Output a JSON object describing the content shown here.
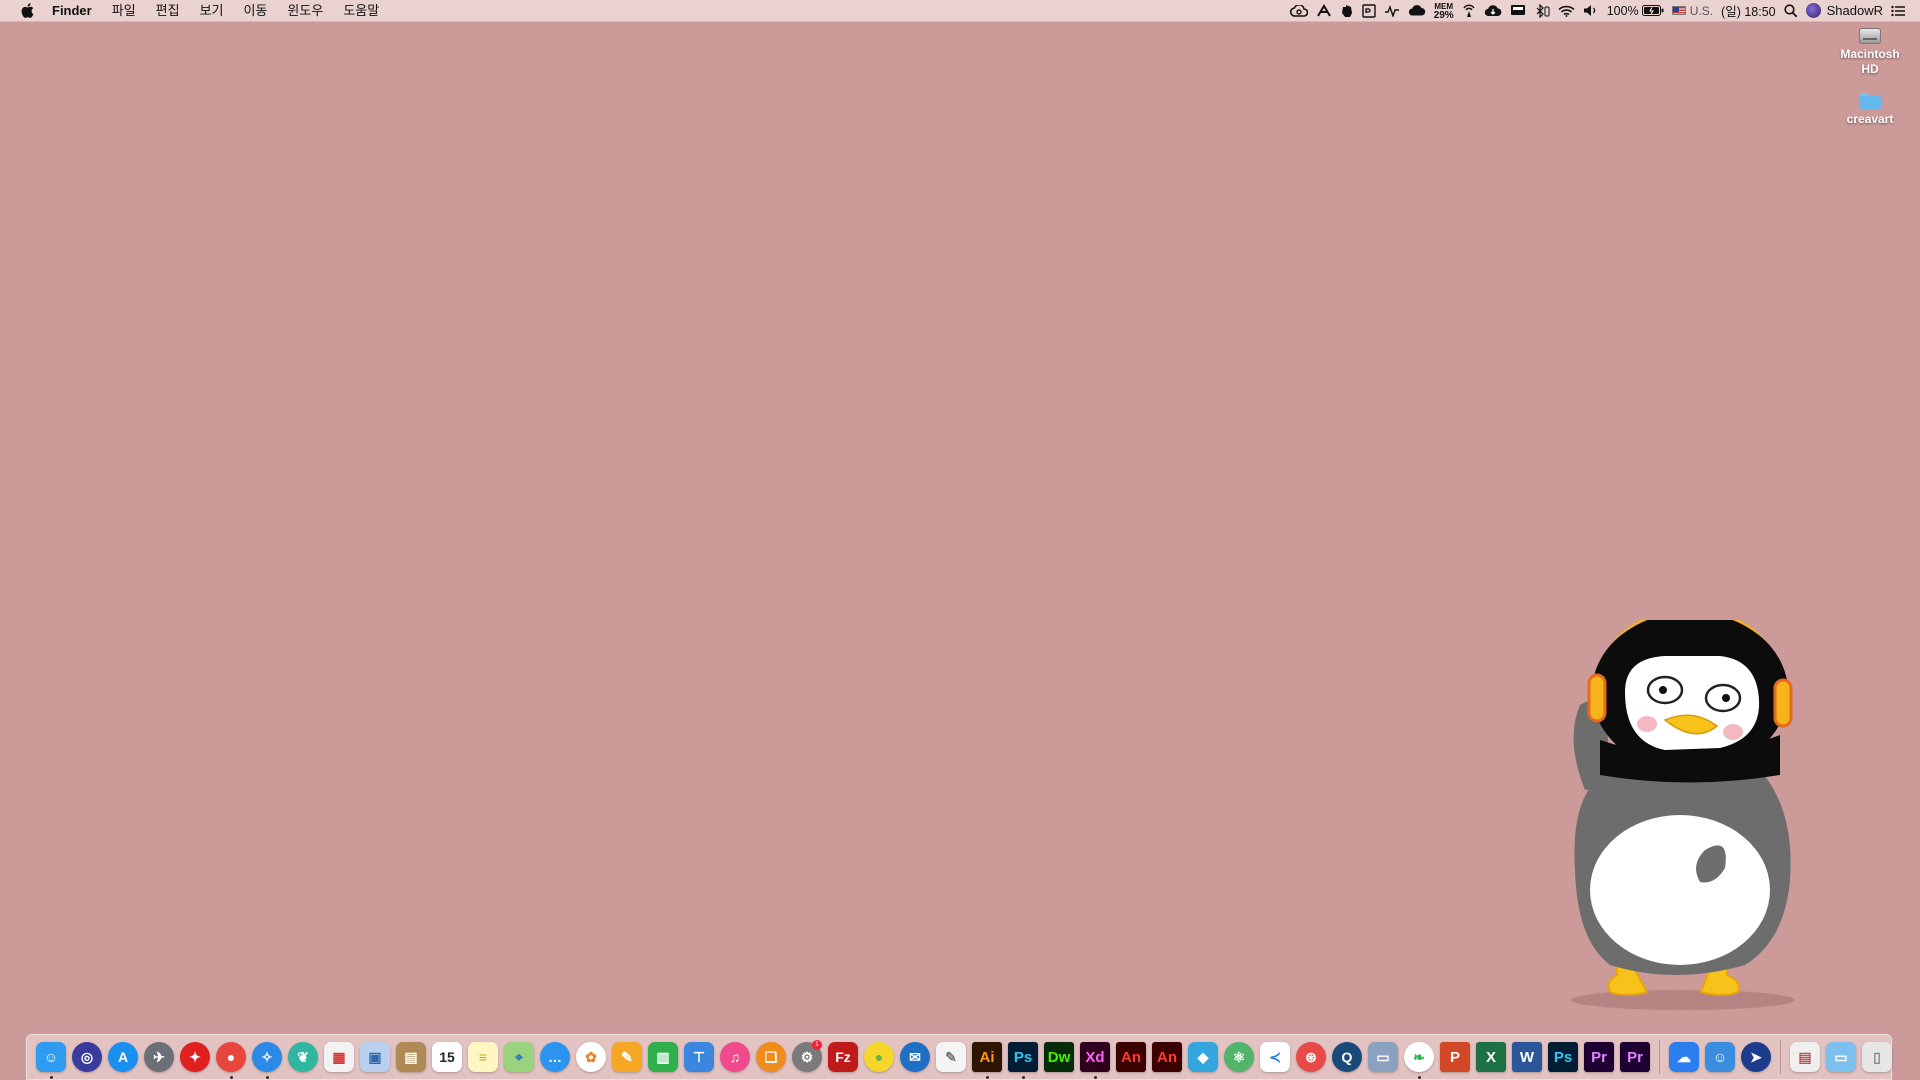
{
  "menubar": {
    "app_name": "Finder",
    "menus": [
      "파일",
      "편집",
      "보기",
      "이동",
      "윈도우",
      "도움말"
    ],
    "status": {
      "mem_label": "MEM",
      "mem_value": "29%",
      "battery": "100%",
      "input_source": "U.S.",
      "clock": "(일) 18:50",
      "user": "ShadowR"
    }
  },
  "desktop": {
    "icons": [
      {
        "label": "Macintosh HD"
      },
      {
        "label": "creavart"
      }
    ]
  },
  "dock": {
    "apps": [
      {
        "name": "Finder",
        "icon": "finder-icon",
        "bg": "#2f9bf0",
        "glyph": "☺",
        "running": true
      },
      {
        "name": "Siri",
        "icon": "siri-icon",
        "bg": "#3b3b9e",
        "glyph": "◎",
        "round": true
      },
      {
        "name": "App Store",
        "icon": "app-store-icon",
        "bg": "#1a8ff0",
        "glyph": "A",
        "round": true
      },
      {
        "name": "Launchpad",
        "icon": "launchpad-icon",
        "bg": "#6b6f78",
        "glyph": "✈",
        "round": true
      },
      {
        "name": "Adobe Acrobat",
        "icon": "acrobat-icon",
        "bg": "#e0201e",
        "glyph": "✦",
        "round": true
      },
      {
        "name": "Google Chrome",
        "icon": "chrome-icon",
        "bg": "#e8453c",
        "glyph": "●",
        "round": true,
        "running": true
      },
      {
        "name": "Safari",
        "icon": "safari-icon",
        "bg": "#2b8ae8",
        "glyph": "✧",
        "round": true,
        "running": true
      },
      {
        "name": "Twitterrific",
        "icon": "bird-app-icon",
        "bg": "#2fb5a0",
        "glyph": "❦",
        "round": true
      },
      {
        "name": "Grid",
        "icon": "grid-app-icon",
        "bg": "#f2f2f2",
        "glyph": "▦",
        "fg": "#d33"
      },
      {
        "name": "Preview",
        "icon": "preview-icon",
        "bg": "#b9d1ee",
        "glyph": "▣",
        "fg": "#3369a8"
      },
      {
        "name": "Contacts",
        "icon": "contacts-icon",
        "bg": "#b08a55",
        "glyph": "▤"
      },
      {
        "name": "Calendar",
        "icon": "calendar-icon",
        "bg": "#ffffff",
        "glyph": "15",
        "fg": "#222"
      },
      {
        "name": "Notes",
        "icon": "notes-icon",
        "bg": "#fff6c2",
        "glyph": "≡",
        "fg": "#caa400"
      },
      {
        "name": "Maps",
        "icon": "maps-icon",
        "bg": "#9bd27d",
        "glyph": "⌖",
        "fg": "#2a6bd1"
      },
      {
        "name": "Messages",
        "icon": "messages-icon",
        "bg": "#2c93f0",
        "glyph": "…",
        "round": true
      },
      {
        "name": "Photos",
        "icon": "photos-icon",
        "bg": "#ffffff",
        "glyph": "✿",
        "fg": "#e8842c",
        "round": true
      },
      {
        "name": "Pages",
        "icon": "pages-icon",
        "bg": "#f5a623",
        "glyph": "✎"
      },
      {
        "name": "Numbers",
        "icon": "numbers-icon",
        "bg": "#2fb04a",
        "glyph": "▥"
      },
      {
        "name": "Keynote",
        "icon": "keynote-icon",
        "bg": "#3a86e0",
        "glyph": "⊤"
      },
      {
        "name": "iTunes",
        "icon": "itunes-icon",
        "bg": "#f04a8c",
        "glyph": "♫",
        "round": true
      },
      {
        "name": "Books",
        "icon": "books-icon",
        "bg": "#f08c1c",
        "glyph": "❏",
        "round": true
      },
      {
        "name": "System Preferences",
        "icon": "system-preferences-icon",
        "bg": "#7a7a7a",
        "glyph": "⚙",
        "round": true,
        "badge": "1"
      },
      {
        "name": "FileZilla",
        "icon": "filezilla-icon",
        "bg": "#bf1a1a",
        "glyph": "Fz"
      },
      {
        "name": "KakaoTalk",
        "icon": "kakao-icon",
        "bg": "#f7d62a",
        "glyph": "●",
        "fg": "#6bb04a",
        "round": true
      },
      {
        "name": "Airmail",
        "icon": "mail-app-icon",
        "bg": "#1f6fc4",
        "glyph": "✉",
        "round": true
      },
      {
        "name": "TextEdit",
        "icon": "textedit-icon",
        "bg": "#f4f4f4",
        "glyph": "✎",
        "fg": "#777"
      },
      {
        "name": "Illustrator",
        "icon": "illustrator-icon",
        "bg": "#2d1500",
        "glyph": "Ai",
        "fg": "#ff9a00",
        "adobe": true,
        "running": true
      },
      {
        "name": "Photoshop",
        "icon": "photoshop-icon",
        "bg": "#001d34",
        "glyph": "Ps",
        "fg": "#31c5f0",
        "adobe": true,
        "running": true
      },
      {
        "name": "Dreamweaver",
        "icon": "dreamweaver-icon",
        "bg": "#062c0a",
        "glyph": "Dw",
        "fg": "#4bf000",
        "adobe": true
      },
      {
        "name": "Adobe XD",
        "icon": "xd-icon",
        "bg": "#2e001e",
        "glyph": "Xd",
        "fg": "#ff61f6",
        "adobe": true,
        "running": true
      },
      {
        "name": "Animate",
        "icon": "animate-icon",
        "bg": "#3a0000",
        "glyph": "An",
        "fg": "#ff3a2a",
        "adobe": true
      },
      {
        "name": "Animate 2",
        "icon": "animate-icon",
        "bg": "#3a0000",
        "glyph": "An",
        "fg": "#ff3a2a",
        "adobe": true
      },
      {
        "name": "Squares",
        "icon": "squares-app-icon",
        "bg": "#33a6e0",
        "glyph": "◆"
      },
      {
        "name": "Atom",
        "icon": "atom-icon",
        "bg": "#52b36a",
        "glyph": "⚛",
        "round": true
      },
      {
        "name": "Visual Studio Code",
        "icon": "vscode-icon",
        "bg": "#ffffff",
        "glyph": "≺",
        "fg": "#1f7fd6"
      },
      {
        "name": "Record",
        "icon": "record-icon",
        "bg": "#e84a4a",
        "glyph": "⊛",
        "round": true
      },
      {
        "name": "QuickTime",
        "icon": "quicktime-icon",
        "bg": "#1a4a7a",
        "glyph": "Q",
        "round": true
      },
      {
        "name": "Scanner",
        "icon": "scanner-icon",
        "bg": "#8aa2c0",
        "glyph": "▭"
      },
      {
        "name": "Evernote",
        "icon": "evernote-icon",
        "bg": "#ffffff",
        "glyph": "❧",
        "fg": "#2db14a",
        "round": true,
        "running": true
      },
      {
        "name": "PowerPoint",
        "icon": "powerpoint-icon",
        "bg": "#d24726",
        "glyph": "P",
        "adobe": true
      },
      {
        "name": "Excel",
        "icon": "excel-icon",
        "bg": "#1e7145",
        "glyph": "X",
        "adobe": true
      },
      {
        "name": "Word",
        "icon": "word-icon",
        "bg": "#2b579a",
        "glyph": "W",
        "adobe": true
      },
      {
        "name": "Photoshop 2",
        "icon": "photoshop-icon",
        "bg": "#001d34",
        "glyph": "Ps",
        "fg": "#31c5f0",
        "adobe": true
      },
      {
        "name": "Premiere Pro",
        "icon": "premiere-icon",
        "bg": "#1f0033",
        "glyph": "Pr",
        "fg": "#e086ff",
        "adobe": true
      },
      {
        "name": "Premiere Pro 2",
        "icon": "premiere-icon",
        "bg": "#1f0033",
        "glyph": "Pr",
        "fg": "#e086ff",
        "adobe": true
      }
    ],
    "utilities": [
      {
        "name": "Messenger",
        "icon": "chat-app-icon",
        "bg": "#2a7ef0",
        "glyph": "☁"
      },
      {
        "name": "Finder Window",
        "icon": "finder-window-icon",
        "bg": "#3b8de0",
        "glyph": "☺"
      },
      {
        "name": "Navigator",
        "icon": "navigator-icon",
        "bg": "#1e3c8c",
        "glyph": "➤",
        "round": true
      }
    ],
    "stacks": [
      {
        "name": "Downloads",
        "icon": "downloads-stack-icon",
        "bg": "#efefef",
        "glyph": "▤",
        "fg": "#c05050"
      },
      {
        "name": "Folder",
        "icon": "folder-stack-icon",
        "bg": "#7dc0ee",
        "glyph": "▭"
      },
      {
        "name": "Trash",
        "icon": "trash-icon",
        "bg": "#e6e6e6",
        "glyph": "▯",
        "fg": "#888"
      }
    ]
  }
}
